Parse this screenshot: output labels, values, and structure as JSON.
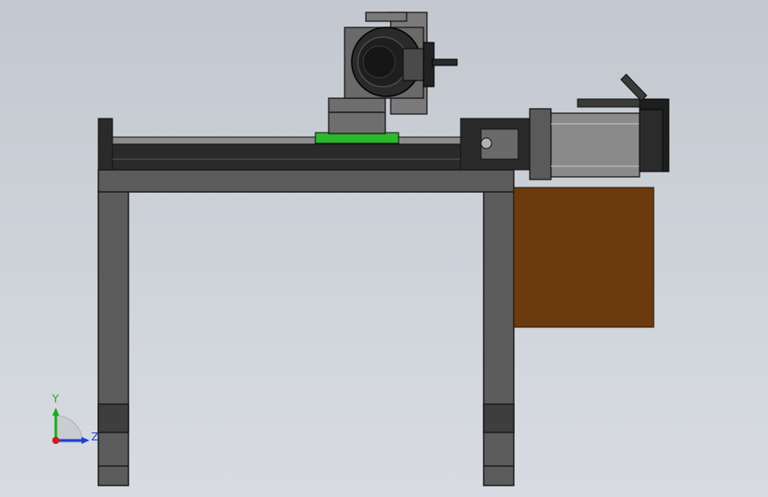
{
  "viewport": {
    "view_orientation": "right",
    "background_top": "#c3c8d0",
    "background_bottom": "#d8dce2"
  },
  "colors": {
    "frame": "#5c5c5c",
    "frame_edge": "#1c1c1c",
    "frame_shadow": "#3e3e3e",
    "rail": "#2a2a2a",
    "rail_top": "#8c8c8c",
    "carriage_plate": "#2db82d",
    "block": "#6e6e6e",
    "motor_body": "#8a8a8a",
    "motor_end": "#1e1e1e",
    "brown_box": "#6b3a0d"
  },
  "triad": {
    "y_label": "Y",
    "z_label": "Z",
    "y_axis_color": "#1fa81f",
    "z_axis_color": "#1f3fd8",
    "origin_color": "#c81e1e"
  },
  "parts": [
    "frame-table",
    "linear-module",
    "servo-motor",
    "rotary-head",
    "electrical-box"
  ]
}
